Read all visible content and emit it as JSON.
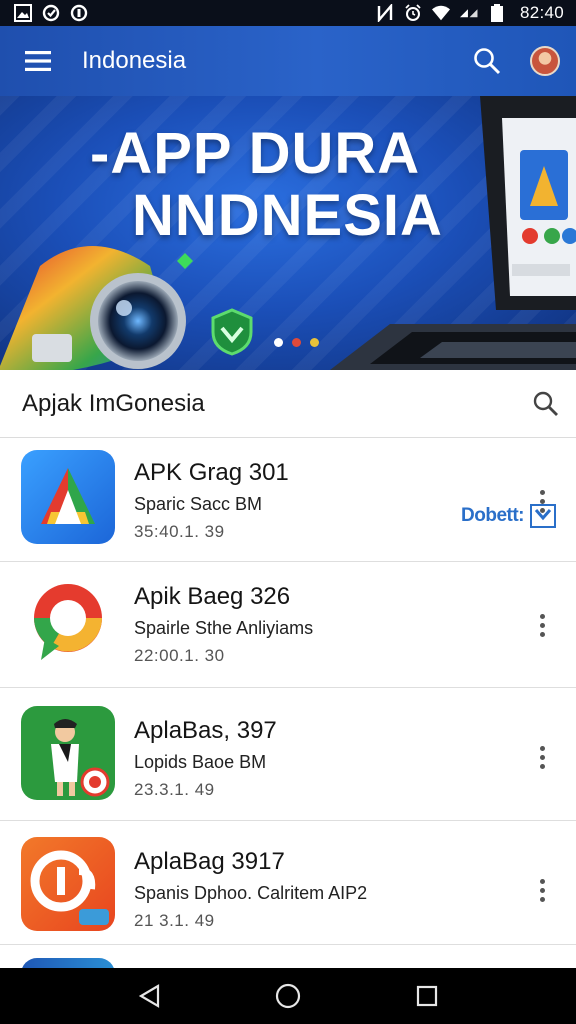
{
  "status_bar": {
    "time": "82:40",
    "icons": [
      "gallery-icon",
      "sync-icon",
      "data-saver-icon",
      "nfc-icon",
      "alarm-icon",
      "wifi-icon",
      "signal-icon",
      "battery-icon"
    ]
  },
  "app_bar": {
    "title": "Indonesia",
    "icons": [
      "menu-icon",
      "search-icon",
      "avatar"
    ]
  },
  "banner": {
    "line1": "-APP DURA",
    "line2": "NNDNESIA",
    "page_dots": 3,
    "active_dot_colors": [
      "#ffffff",
      "#e04a3a",
      "#e8c23a"
    ]
  },
  "search_section": {
    "title": "Apjak ImGonesia",
    "icon": "search-icon"
  },
  "apps": [
    {
      "name": "APK Grag 301",
      "subtitle": "Sparic Sacc BM",
      "meta": "35:40.1. 39",
      "icon": "app-a-icon",
      "badge": "Dobett:"
    },
    {
      "name": "Apik Baeg 326",
      "subtitle": "Spairle Sthe Anliyiams",
      "meta": "22:00.1. 30",
      "icon": "chrome-like-icon"
    },
    {
      "name": "AplaBas, 397",
      "subtitle": "Lopids Baoe BM",
      "meta": "23.3.1. 49",
      "icon": "player-icon"
    },
    {
      "name": "AplaBag 3917",
      "subtitle": "Spanis Dphoo. Calritem AIP2",
      "meta": "21 3.1. 49",
      "icon": "orange-app-icon"
    }
  ],
  "nav_bar": {
    "icons": [
      "back-icon",
      "home-icon",
      "recents-icon"
    ]
  },
  "colors": {
    "app_bar": "#2a63c9",
    "banner": "#1b4fb8",
    "status_bar": "#0a0f1a",
    "nav_bar": "#000000"
  }
}
